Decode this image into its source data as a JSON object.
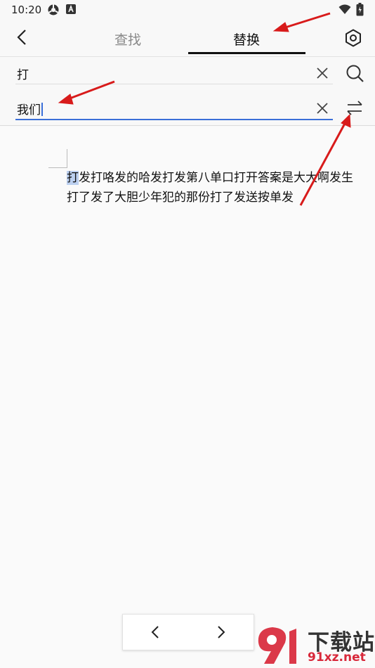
{
  "status": {
    "time": "10:20"
  },
  "header": {
    "tab_find": "查找",
    "tab_replace": "替换"
  },
  "find": {
    "value": "打"
  },
  "replace": {
    "value": "我们"
  },
  "document": {
    "highlight": "打",
    "line1_rest": "发打咯发的哈发打发第八单口打开答案是大大啊发生",
    "line2": "打了发了大胆少年犯的那份打了发送按单发"
  },
  "watermark": {
    "brand": "下载站",
    "url": "91xz.net"
  },
  "colors": {
    "accent": "#3a6fd8",
    "annotation": "#d81b1b",
    "logo_red": "#d8283a"
  }
}
